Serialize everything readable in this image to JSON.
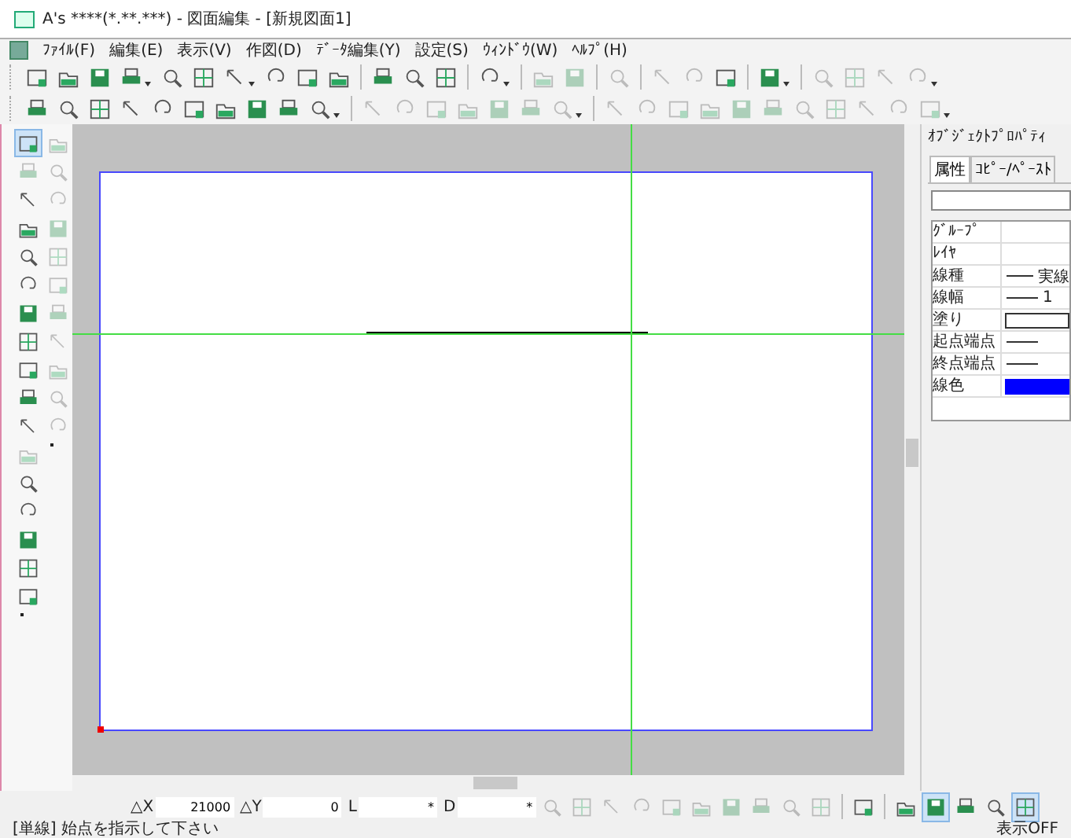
{
  "window": {
    "title": "A's ****(*.**.***) - 図面編集 - [新規図面1]"
  },
  "menu": [
    "ﾌｧｲﾙ(F)",
    "編集(E)",
    "表示(V)",
    "作図(D)",
    "ﾃﾞｰﾀ編集(Y)",
    "設定(S)",
    "ｳｨﾝﾄﾞｳ(W)",
    "ﾍﾙﾌﾟ(H)"
  ],
  "toolbars": [
    [
      {
        "kind": "button",
        "disabled": false,
        "dropdown": false
      },
      {
        "kind": "button",
        "disabled": false,
        "dropdown": false
      },
      {
        "kind": "button",
        "disabled": false,
        "dropdown": false
      },
      {
        "kind": "button",
        "disabled": false,
        "dropdown": true
      },
      {
        "kind": "button",
        "disabled": false,
        "dropdown": false
      },
      {
        "kind": "button",
        "disabled": false,
        "dropdown": false
      },
      {
        "kind": "button",
        "disabled": false,
        "dropdown": true
      },
      {
        "kind": "button",
        "disabled": false,
        "dropdown": false
      },
      {
        "kind": "button",
        "disabled": false,
        "dropdown": false
      },
      {
        "kind": "button",
        "disabled": false,
        "dropdown": false
      },
      {
        "kind": "separator"
      },
      {
        "kind": "button",
        "disabled": false,
        "dropdown": false
      },
      {
        "kind": "button",
        "disabled": false,
        "dropdown": false
      },
      {
        "kind": "button",
        "disabled": false,
        "dropdown": false
      },
      {
        "kind": "separator"
      },
      {
        "kind": "button",
        "disabled": false,
        "dropdown": true
      },
      {
        "kind": "separator"
      },
      {
        "kind": "button",
        "disabled": true,
        "dropdown": false
      },
      {
        "kind": "button",
        "disabled": true,
        "dropdown": false
      },
      {
        "kind": "separator"
      },
      {
        "kind": "button",
        "disabled": true,
        "dropdown": false
      },
      {
        "kind": "separator"
      },
      {
        "kind": "button",
        "disabled": true,
        "dropdown": false
      },
      {
        "kind": "button",
        "disabled": true,
        "dropdown": false
      },
      {
        "kind": "button",
        "disabled": false,
        "dropdown": false
      },
      {
        "kind": "separator"
      },
      {
        "kind": "button",
        "disabled": false,
        "dropdown": true
      },
      {
        "kind": "separator"
      },
      {
        "kind": "button",
        "disabled": true,
        "dropdown": false
      },
      {
        "kind": "button",
        "disabled": true,
        "dropdown": false
      },
      {
        "kind": "button",
        "disabled": true,
        "dropdown": false
      },
      {
        "kind": "button",
        "disabled": true,
        "dropdown": true
      }
    ],
    [
      {
        "kind": "button",
        "disabled": false,
        "dropdown": false
      },
      {
        "kind": "button",
        "disabled": false,
        "dropdown": false
      },
      {
        "kind": "button",
        "disabled": false,
        "dropdown": false
      },
      {
        "kind": "button",
        "disabled": false,
        "dropdown": false
      },
      {
        "kind": "button",
        "disabled": false,
        "dropdown": false
      },
      {
        "kind": "button",
        "disabled": false,
        "dropdown": false
      },
      {
        "kind": "button",
        "disabled": false,
        "dropdown": false
      },
      {
        "kind": "button",
        "disabled": false,
        "dropdown": false
      },
      {
        "kind": "button",
        "disabled": false,
        "dropdown": false
      },
      {
        "kind": "button",
        "disabled": false,
        "dropdown": true
      },
      {
        "kind": "separator"
      },
      {
        "kind": "button",
        "disabled": true,
        "dropdown": false
      },
      {
        "kind": "button",
        "disabled": true,
        "dropdown": false
      },
      {
        "kind": "button",
        "disabled": true,
        "dropdown": false
      },
      {
        "kind": "button",
        "disabled": true,
        "dropdown": false
      },
      {
        "kind": "button",
        "disabled": true,
        "dropdown": false
      },
      {
        "kind": "button",
        "disabled": true,
        "dropdown": false
      },
      {
        "kind": "button",
        "disabled": true,
        "dropdown": true
      },
      {
        "kind": "separator"
      },
      {
        "kind": "button",
        "disabled": true,
        "dropdown": false
      },
      {
        "kind": "button",
        "disabled": true,
        "dropdown": false
      },
      {
        "kind": "button",
        "disabled": true,
        "dropdown": false
      },
      {
        "kind": "button",
        "disabled": true,
        "dropdown": false
      },
      {
        "kind": "button",
        "disabled": true,
        "dropdown": false
      },
      {
        "kind": "button",
        "disabled": true,
        "dropdown": false
      },
      {
        "kind": "button",
        "disabled": true,
        "dropdown": false
      },
      {
        "kind": "button",
        "disabled": true,
        "dropdown": false
      },
      {
        "kind": "button",
        "disabled": true,
        "dropdown": false
      },
      {
        "kind": "button",
        "disabled": true,
        "dropdown": false
      },
      {
        "kind": "button",
        "disabled": true,
        "dropdown": true
      }
    ]
  ],
  "palette": {
    "left": [
      {
        "selected": true,
        "disabled": false
      },
      {
        "selected": false,
        "disabled": true
      },
      {
        "selected": false,
        "disabled": false
      },
      {
        "selected": false,
        "disabled": false
      },
      {
        "selected": false,
        "disabled": false
      },
      {
        "selected": false,
        "disabled": false
      },
      {
        "selected": false,
        "disabled": false
      },
      {
        "selected": false,
        "disabled": false
      },
      {
        "selected": false,
        "disabled": false
      },
      {
        "selected": false,
        "disabled": false
      },
      {
        "selected": false,
        "disabled": false
      },
      {
        "selected": false,
        "disabled": true
      },
      {
        "selected": false,
        "disabled": false
      },
      {
        "selected": false,
        "disabled": false
      },
      {
        "selected": false,
        "disabled": false
      },
      {
        "selected": false,
        "disabled": false
      },
      {
        "selected": false,
        "disabled": false
      }
    ],
    "right": [
      {
        "selected": false,
        "disabled": true
      },
      {
        "selected": false,
        "disabled": true
      },
      {
        "selected": false,
        "disabled": true
      },
      {
        "selected": false,
        "disabled": true
      },
      {
        "selected": false,
        "disabled": true
      },
      {
        "selected": false,
        "disabled": true
      },
      {
        "selected": false,
        "disabled": true
      },
      {
        "selected": false,
        "disabled": true
      },
      {
        "selected": false,
        "disabled": true
      },
      {
        "selected": false,
        "disabled": true
      },
      {
        "selected": false,
        "disabled": true
      }
    ]
  },
  "properties_panel": {
    "title": "ｵﾌﾞｼﾞｪｸﾄﾌﾟﾛﾊﾟﾃｨ",
    "tabs": [
      {
        "label": "属性",
        "selected": true
      },
      {
        "label": "ｺﾋﾟｰ/ﾍﾟｰｽﾄ",
        "selected": false
      }
    ],
    "rows": [
      {
        "label": "ｸﾞﾙｰﾌﾟ",
        "kind": "empty"
      },
      {
        "label": "ﾚｲﾔ",
        "kind": "empty"
      },
      {
        "label": "線種",
        "kind": "line",
        "value": "実線"
      },
      {
        "label": "線幅",
        "kind": "line",
        "value": "1"
      },
      {
        "label": "塗り",
        "kind": "box"
      },
      {
        "label": "起点端点",
        "kind": "line"
      },
      {
        "label": "終点端点",
        "kind": "line"
      },
      {
        "label": "線色",
        "kind": "color",
        "color": "#0000ff"
      }
    ]
  },
  "coordinate_bar": [
    {
      "label": "△X",
      "value": "21000"
    },
    {
      "label": "△Y",
      "value": "0"
    },
    {
      "label": "L",
      "value": "*"
    },
    {
      "label": "D",
      "value": "*"
    }
  ],
  "snap_tools": [
    {
      "disabled": true,
      "selected": false
    },
    {
      "disabled": true,
      "selected": false
    },
    {
      "disabled": true,
      "selected": false
    },
    {
      "disabled": true,
      "selected": false
    },
    {
      "disabled": true,
      "selected": false
    },
    {
      "disabled": true,
      "selected": false
    },
    {
      "disabled": true,
      "selected": false
    },
    {
      "disabled": true,
      "selected": false
    },
    {
      "disabled": true,
      "selected": false
    },
    {
      "disabled": true,
      "selected": false
    }
  ],
  "view_tools": [
    {
      "disabled": false,
      "selected": false
    },
    {
      "disabled": false,
      "selected": false
    },
    {
      "disabled": false,
      "selected": true
    },
    {
      "disabled": false,
      "selected": false
    },
    {
      "disabled": false,
      "selected": false
    },
    {
      "disabled": false,
      "selected": true
    }
  ],
  "status_bar": {
    "message": "[単線] 始点を指示して下さい",
    "indicator": "表示OFF"
  }
}
